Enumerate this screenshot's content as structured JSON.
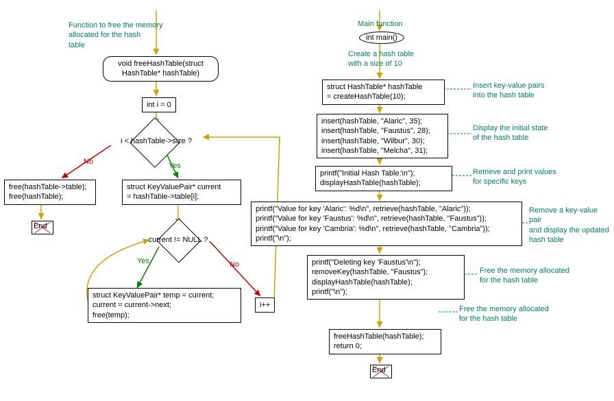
{
  "left": {
    "comment_top": "Function to free the memory\nallocated for the hash\ntable",
    "func_sig": "void freeHashTable(struct\n   HashTable* hashTable)",
    "init": "int i = 0",
    "cond1": "i < hashTable->size ?",
    "no_branch": "free(hashTable->table);\nfree(hashTable);",
    "yes_branch": "struct KeyValuePair* current\n= hashTable->table[i];",
    "cond2": "current != NULL ?",
    "loop_body": "struct KeyValuePair* temp = current;\ncurrent = current->next;\nfree(temp);",
    "inc": "i++",
    "yes": "Yes",
    "no": "No",
    "end": "End"
  },
  "right": {
    "comment_main": "Main function",
    "main_sig": "int main()",
    "comment_create": "Create a hash table\nwith a size of 10",
    "create": "struct HashTable* hashTable\n= createHashTable(10);",
    "comment_insert": "Insert key-value pairs\ninto the hash table",
    "inserts": "insert(hashTable, \"Alaric\", 35);\ninsert(hashTable, \"Faustus\", 28);\ninsert(hashTable, \"Wilbur\", 30);\ninsert(hashTable, \"Melcha\", 31);",
    "comment_display": "Display the initial state\nof the hash table",
    "display1": "printf(\"Initial Hash Table:\\n\");\ndisplayHashTable(hashTable);",
    "comment_retrieve": "Retrieve and print values\nfor specific keys",
    "retrieve": "printf(\"Value for key 'Alaric': %d\\n\", retrieve(hashTable, \"Alaric\"));\nprintf(\"Value for key 'Faustus': %d\\n\", retrieve(hashTable, \"Faustus\"));\nprintf(\"Value for key 'Cambria': %d\\n\", retrieve(hashTable, \"Cambria\"));\nprintf(\"\\n\");",
    "comment_remove": "Remove a key-value pair\nand display the updated\nhash table",
    "remove": "printf(\"Deleting key 'Faustus'\\n\");\nremoveKey(hashTable, \"Faustus\");\ndisplayHashTable(hashTable);\nprintf(\"\\n\");",
    "comment_free": "Free the memory allocated\nfor the hash table",
    "free_ret": "freeHashTable(hashTable);\nreturn 0;",
    "end": "End"
  }
}
